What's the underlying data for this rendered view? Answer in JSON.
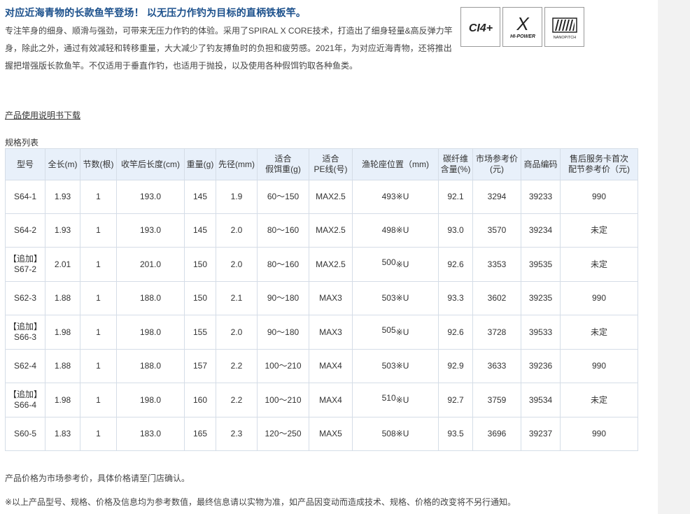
{
  "heading": "对应近海青物的长款鱼竿登场！ 以无压力作钓为目标的直柄铁板竿。",
  "description": "专注竿身的细身、顺滑与强劲，可带来无压力作钓的体验。采用了SPIRAL X CORE技术，打造出了细身轻量&高反弹力竿身，除此之外，通过有效减轻和转移重量，大大减少了钓友搏鱼时的负担和疲劳感。2021年，为对应近海青物，还将推出握把增强版长款鱼竿。不仅适用于垂直作钓，也适用于抛投，以及使用各种假饵钓取各种鱼类。",
  "badges": [
    {
      "text": "CI4+",
      "icon": "ci4-plus-logo"
    },
    {
      "text": "X",
      "subtext": "HI-POWER",
      "icon": "hi-power-x-logo"
    },
    {
      "text": "NANOPITCH",
      "icon": "nanopitch-logo"
    }
  ],
  "manual_link": "产品使用说明书下载",
  "spec_title": "规格列表",
  "table": {
    "headers": [
      {
        "l1": "型号",
        "l2": ""
      },
      {
        "l1": "全长(m)",
        "l2": ""
      },
      {
        "l1": "节数(根)",
        "l2": ""
      },
      {
        "l1": "收竿后长度(cm)",
        "l2": ""
      },
      {
        "l1": "重量(g)",
        "l2": ""
      },
      {
        "l1": "先径(mm)",
        "l2": ""
      },
      {
        "l1": "适合",
        "l2": "假饵重(g)"
      },
      {
        "l1": "适合",
        "l2": "PE线(号)"
      },
      {
        "l1": "渔轮座位置（mm)",
        "l2": ""
      },
      {
        "l1": "碳纤维",
        "l2": "含量(%)"
      },
      {
        "l1": "市场参考价",
        "l2": "(元)"
      },
      {
        "l1": "商品编码",
        "l2": ""
      },
      {
        "l1": "售后服务卡首次",
        "l2": "配节参考价（元)"
      }
    ],
    "rows": [
      {
        "tag": "",
        "model": "S64-1",
        "length": "1.93",
        "pieces": "1",
        "closed": "193.0",
        "weight": "145",
        "tip": "1.9",
        "lure": "60～150",
        "pe": "MAX2.5",
        "seat_num": "493",
        "seat_unit": "※U",
        "seat_style": "small",
        "carbon": "92.1",
        "price": "3294",
        "code": "39233",
        "service": "990"
      },
      {
        "tag": "",
        "model": "S64-2",
        "length": "1.93",
        "pieces": "1",
        "closed": "193.0",
        "weight": "145",
        "tip": "2.0",
        "lure": "80～160",
        "pe": "MAX2.5",
        "seat_num": "498",
        "seat_unit": "※U",
        "seat_style": "small",
        "carbon": "93.0",
        "price": "3570",
        "code": "39234",
        "service": "未定"
      },
      {
        "tag": "【追加】",
        "model": "S67-2",
        "length": "2.01",
        "pieces": "1",
        "closed": "201.0",
        "weight": "150",
        "tip": "2.0",
        "lure": "80～160",
        "pe": "MAX2.5",
        "seat_num": "500",
        "seat_unit": "※U",
        "seat_style": "big",
        "carbon": "92.6",
        "price": "3353",
        "code": "39535",
        "service": "未定"
      },
      {
        "tag": "",
        "model": "S62-3",
        "length": "1.88",
        "pieces": "1",
        "closed": "188.0",
        "weight": "150",
        "tip": "2.1",
        "lure": "90～180",
        "pe": "MAX3",
        "seat_num": "503",
        "seat_unit": "※U",
        "seat_style": "small",
        "carbon": "93.3",
        "price": "3602",
        "code": "39235",
        "service": "990"
      },
      {
        "tag": "【追加】",
        "model": "S66-3",
        "length": "1.98",
        "pieces": "1",
        "closed": "198.0",
        "weight": "155",
        "tip": "2.0",
        "lure": "90～180",
        "pe": "MAX3",
        "seat_num": "505",
        "seat_unit": "※U",
        "seat_style": "big",
        "carbon": "92.6",
        "price": "3728",
        "code": "39533",
        "service": "未定"
      },
      {
        "tag": "",
        "model": "S62-4",
        "length": "1.88",
        "pieces": "1",
        "closed": "188.0",
        "weight": "157",
        "tip": "2.2",
        "lure": "100～210",
        "pe": "MAX4",
        "seat_num": "503",
        "seat_unit": "※U",
        "seat_style": "small",
        "carbon": "92.9",
        "price": "3633",
        "code": "39236",
        "service": "990"
      },
      {
        "tag": "【追加】",
        "model": "S66-4",
        "length": "1.98",
        "pieces": "1",
        "closed": "198.0",
        "weight": "160",
        "tip": "2.2",
        "lure": "100～210",
        "pe": "MAX4",
        "seat_num": "510",
        "seat_unit": "※U",
        "seat_style": "big",
        "carbon": "92.7",
        "price": "3759",
        "code": "39534",
        "service": "未定"
      },
      {
        "tag": "",
        "model": "S60-5",
        "length": "1.83",
        "pieces": "1",
        "closed": "183.0",
        "weight": "165",
        "tip": "2.3",
        "lure": "120～250",
        "pe": "MAX5",
        "seat_num": "508",
        "seat_unit": "※U",
        "seat_style": "small",
        "carbon": "93.5",
        "price": "3696",
        "code": "39237",
        "service": "990"
      }
    ]
  },
  "note_price": "产品价格为市场参考价，具体价格请至门店确认。",
  "note_disclaimer": "※以上产品型号、规格、价格及信息均为参考数值，最终信息请以实物为准，如产品因变动而造成技术、规格、价格的改变将不另行通知。"
}
